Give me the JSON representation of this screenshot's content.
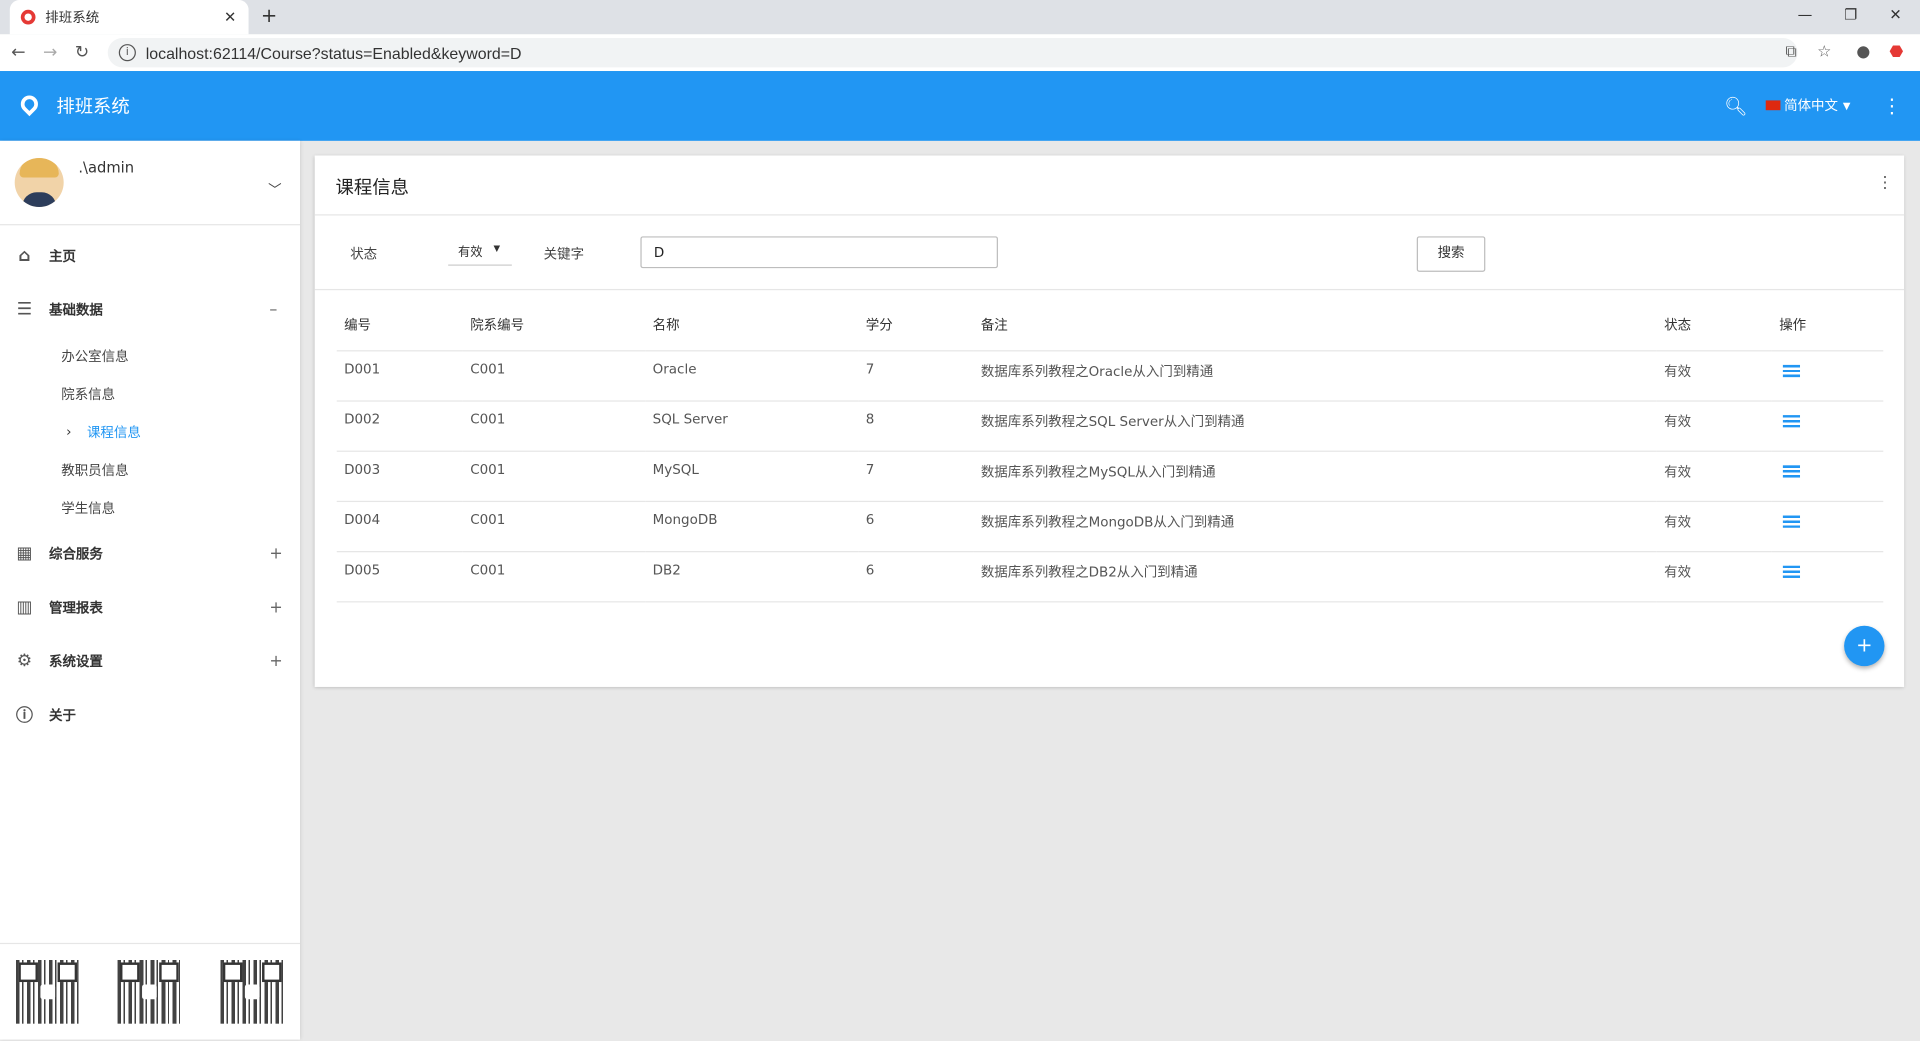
{
  "browser": {
    "tab_title": "排班系统",
    "url": "localhost:62114/Course?status=Enabled&keyword=D"
  },
  "app": {
    "title": "排班系统",
    "language": "简体中文",
    "accent_color": "#2196f3"
  },
  "sidebar": {
    "username": ".\\admin",
    "items": [
      {
        "label": "主页",
        "icon": "home-icon"
      },
      {
        "label": "基础数据",
        "icon": "list-icon",
        "toggle": "–"
      },
      {
        "label": "综合服务",
        "icon": "building-icon",
        "toggle": "+"
      },
      {
        "label": "管理报表",
        "icon": "chart-icon",
        "toggle": "+"
      },
      {
        "label": "系统设置",
        "icon": "gear-icon",
        "toggle": "+"
      },
      {
        "label": "关于",
        "icon": "info-icon"
      }
    ],
    "sub_items": [
      "办公室信息",
      "院系信息",
      "课程信息",
      "教职员信息",
      "学生信息"
    ]
  },
  "card": {
    "title": "课程信息",
    "filters": {
      "status_label": "状态",
      "status_value": "有效",
      "keyword_label": "关键字",
      "keyword_value": "D",
      "search_button": "搜索"
    },
    "table": {
      "headers": [
        "编号",
        "院系编号",
        "名称",
        "学分",
        "备注",
        "状态",
        "操作"
      ],
      "rows": [
        [
          "D001",
          "C001",
          "Oracle",
          "7",
          "数据库系列教程之Oracle从入门到精通",
          "有效"
        ],
        [
          "D002",
          "C001",
          "SQL Server",
          "8",
          "数据库系列教程之SQL Server从入门到精通",
          "有效"
        ],
        [
          "D003",
          "C001",
          "MySQL",
          "7",
          "数据库系列教程之MySQL从入门到精通",
          "有效"
        ],
        [
          "D004",
          "C001",
          "MongoDB",
          "6",
          "数据库系列教程之MongoDB从入门到精通",
          "有效"
        ],
        [
          "D005",
          "C001",
          "DB2",
          "6",
          "数据库系列教程之DB2从入门到精通",
          "有效"
        ]
      ]
    }
  }
}
